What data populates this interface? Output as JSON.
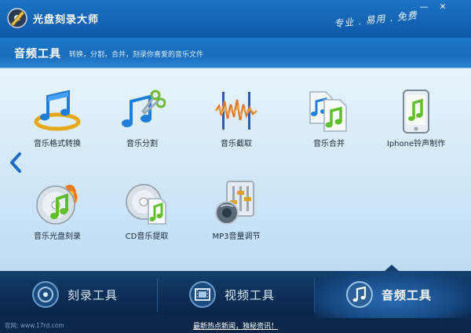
{
  "window": {
    "title": "光盘刻录大师",
    "slogan": "专业 . 易用 . 免费",
    "minimize_icon": "minimize-icon",
    "close_icon": "close-icon"
  },
  "section": {
    "title": "音频工具",
    "description": "转换，分割，合并，刻录你喜爱的音乐文件"
  },
  "tools": [
    {
      "label": "音乐格式转换",
      "icon": "music-convert-icon"
    },
    {
      "label": "音乐分割",
      "icon": "music-split-icon"
    },
    {
      "label": "音乐截取",
      "icon": "music-trim-icon"
    },
    {
      "label": "音乐合并",
      "icon": "music-merge-icon"
    },
    {
      "label": "Iphone铃声制作",
      "icon": "iphone-ringtone-icon"
    },
    {
      "label": "音乐光盘刻录",
      "icon": "music-disc-burn-icon"
    },
    {
      "label": "CD音乐提取",
      "icon": "cd-extract-icon"
    },
    {
      "label": "MP3音量调节",
      "icon": "mp3-volume-icon"
    }
  ],
  "tabs": [
    {
      "label": "刻录工具",
      "icon": "disc-icon",
      "active": false
    },
    {
      "label": "视频工具",
      "icon": "film-icon",
      "active": false
    },
    {
      "label": "音频工具",
      "icon": "music-note-icon",
      "active": true
    }
  ],
  "status": {
    "site": "官网: www.17rd.com",
    "news": "最新热点新闻，独秘资讯！"
  },
  "colors": {
    "titlebar": "#1667b8",
    "content_bg": "#d6eaf8",
    "tabbar": "#0d2f57",
    "accent_green": "#5fbf2a"
  }
}
